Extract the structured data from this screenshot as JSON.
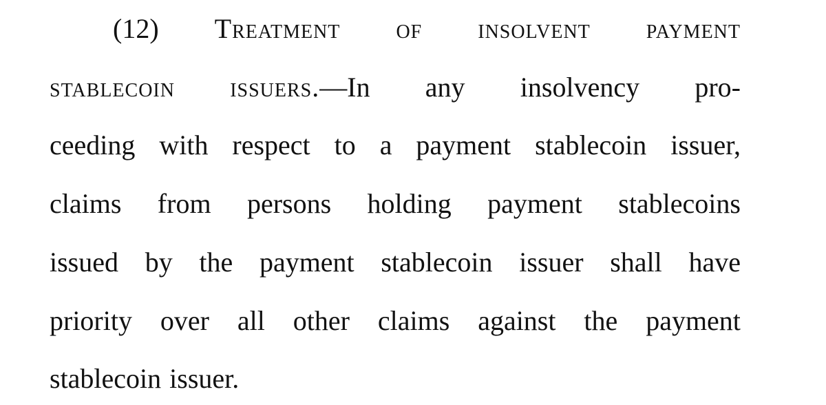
{
  "document": {
    "paragraph_number": "(12)",
    "heading": "Treatment of insolvent payment stablecoin issuers.",
    "lines": [
      [
        "(12)",
        "Treatment",
        "of",
        "insolvent",
        "payment"
      ],
      [
        "stablecoin",
        "issuers.—In",
        "any",
        "insolvency",
        "pro-"
      ],
      [
        "ceeding",
        "with",
        "respect",
        "to",
        "a",
        "payment",
        "stablecoin",
        "issuer,"
      ],
      [
        "claims",
        "from",
        "persons",
        "holding",
        "payment",
        "stablecoins"
      ],
      [
        "issued",
        "by",
        "the",
        "payment",
        "stablecoin",
        "issuer",
        "shall",
        "have"
      ],
      [
        "priority",
        "over",
        "all",
        "other",
        "claims",
        "against",
        "the",
        "payment"
      ],
      [
        "stablecoin",
        "issuer."
      ]
    ]
  }
}
